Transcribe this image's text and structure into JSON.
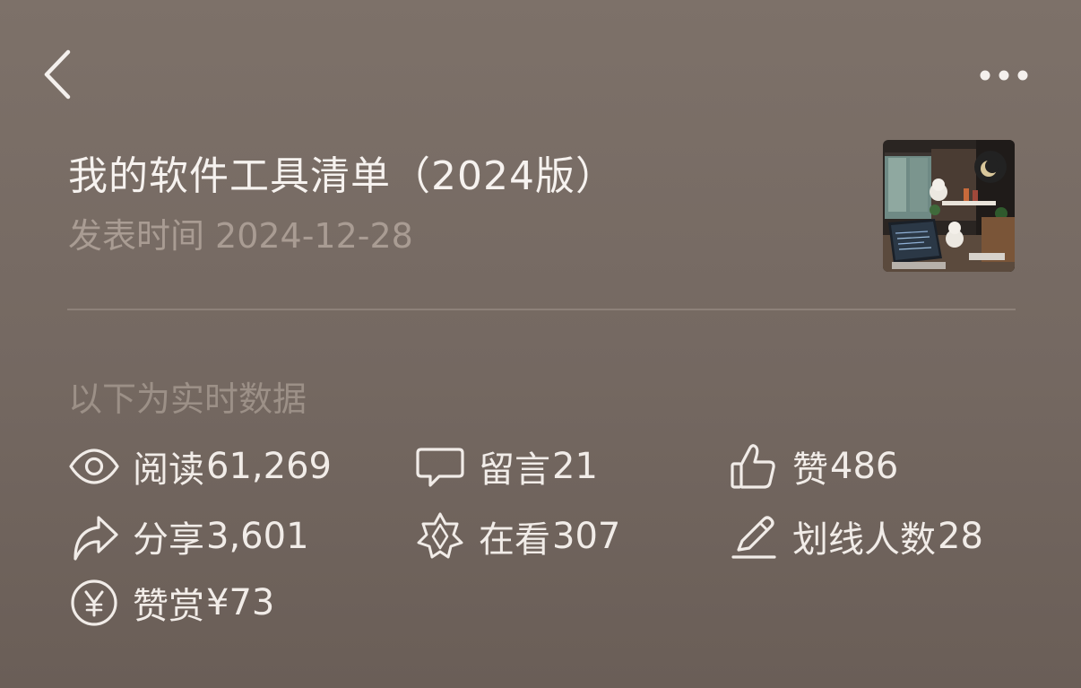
{
  "nav": {
    "back_icon": "chevron-left-icon",
    "more_icon": "more-horizontal-icon"
  },
  "article": {
    "title": "我的软件工具清单（2024版）",
    "publish_label": "发表时间",
    "publish_date": "2024-12-28",
    "cover_alt": "desk setup photo"
  },
  "stats": {
    "caption": "以下为实时数据",
    "items": [
      {
        "label": "阅读",
        "value": "61,269",
        "icon": "eye-icon"
      },
      {
        "label": "留言",
        "value": "21",
        "icon": "comment-icon"
      },
      {
        "label": "赞",
        "value": "486",
        "icon": "thumbs-up-icon"
      },
      {
        "label": "分享",
        "value": "3,601",
        "icon": "share-icon"
      },
      {
        "label": "在看",
        "value": "307",
        "icon": "star-icon"
      },
      {
        "label": "划线人数",
        "value": "28",
        "icon": "pen-icon"
      },
      {
        "label": "赞赏",
        "value": "¥73",
        "icon": "yen-icon"
      }
    ]
  },
  "colors": {
    "background": "#766a63",
    "primary_text": "#f3efec",
    "secondary_text": "#a99c93",
    "divider": "#8d8179"
  }
}
